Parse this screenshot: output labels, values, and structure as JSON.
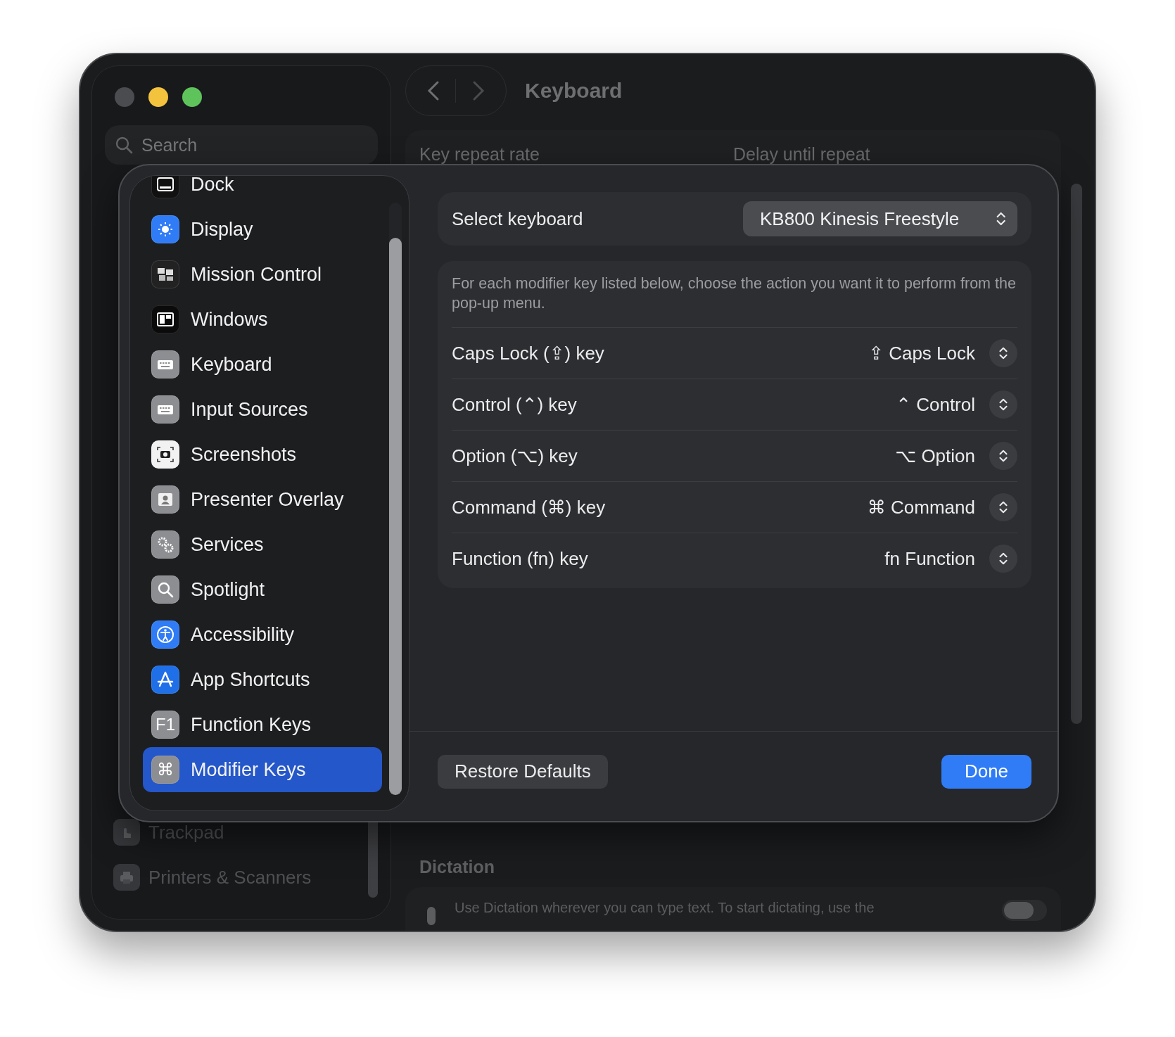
{
  "sidebar": {
    "search": {
      "placeholder": "Search"
    },
    "items": [
      {
        "label": "Trackpad"
      },
      {
        "label": "Printers & Scanners"
      }
    ]
  },
  "header": {
    "title": "Keyboard"
  },
  "background": {
    "key_repeat": {
      "labels": [
        "Key repeat rate",
        "Delay until repeat"
      ]
    },
    "dictation": {
      "heading": "Dictation",
      "description": "Use Dictation wherever you can type text. To start dictating, use the",
      "toggle": {
        "on": false
      }
    }
  },
  "sheet": {
    "categories": [
      {
        "label": "Dock",
        "selected": false
      },
      {
        "label": "Display",
        "selected": false
      },
      {
        "label": "Mission Control",
        "selected": false
      },
      {
        "label": "Windows",
        "selected": false
      },
      {
        "label": "Keyboard",
        "selected": false
      },
      {
        "label": "Input Sources",
        "selected": false
      },
      {
        "label": "Screenshots",
        "selected": false
      },
      {
        "label": "Presenter Overlay",
        "selected": false
      },
      {
        "label": "Services",
        "selected": false
      },
      {
        "label": "Spotlight",
        "selected": false
      },
      {
        "label": "Accessibility",
        "selected": false
      },
      {
        "label": "App Shortcuts",
        "selected": false
      },
      {
        "label": "Function Keys",
        "selected": false,
        "icon_text": "F1"
      },
      {
        "label": "Modifier Keys",
        "selected": true,
        "icon_text": "⌘"
      }
    ],
    "select_keyboard": {
      "label": "Select keyboard",
      "value": "KB800 Kinesis Freestyle"
    },
    "description": "For each modifier key listed below, choose the action you want it to perform from the pop-up menu.",
    "modifiers": [
      {
        "key": "Caps Lock (⇪) key",
        "action": "⇪ Caps Lock"
      },
      {
        "key": "Control (⌃) key",
        "action": "⌃ Control"
      },
      {
        "key": "Option (⌥) key",
        "action": "⌥ Option"
      },
      {
        "key": "Command (⌘) key",
        "action": "⌘ Command"
      },
      {
        "key": "Function (fn) key",
        "action": "fn Function"
      }
    ],
    "buttons": {
      "restore": "Restore Defaults",
      "done": "Done"
    }
  }
}
